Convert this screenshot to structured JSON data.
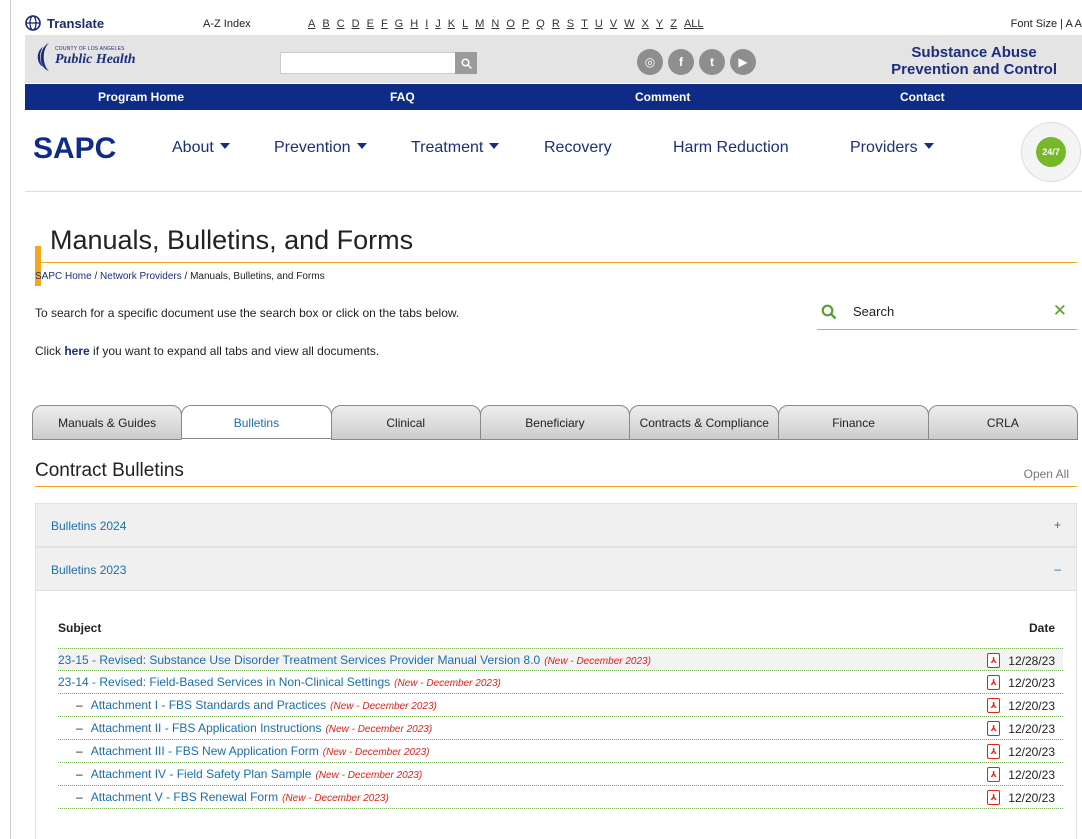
{
  "utility": {
    "translate": "Translate",
    "az_label": "A-Z Index",
    "letters": [
      "A",
      "B",
      "C",
      "D",
      "E",
      "F",
      "G",
      "H",
      "I",
      "J",
      "K",
      "L",
      "M",
      "N",
      "O",
      "P",
      "Q",
      "R",
      "S",
      "T",
      "U",
      "V",
      "W",
      "X",
      "Y",
      "Z",
      "ALL"
    ],
    "font_size": "Font Size | A A"
  },
  "logo": {
    "small": "COUNTY OF LOS ANGELES",
    "big": "Public Health"
  },
  "social": [
    {
      "icon": "instagram-icon",
      "glyph": "◎"
    },
    {
      "icon": "facebook-icon",
      "glyph": "f"
    },
    {
      "icon": "twitter-icon",
      "glyph": "t"
    },
    {
      "icon": "youtube-icon",
      "glyph": "▶"
    }
  ],
  "org": {
    "line1": "Substance Abuse",
    "line2": "Prevention and Control"
  },
  "navband": [
    "Program Home",
    "FAQ",
    "Comment",
    "Contact"
  ],
  "brand": "SAPC",
  "mainnav": [
    {
      "label": "About",
      "dropdown": true
    },
    {
      "label": "Prevention",
      "dropdown": true
    },
    {
      "label": "Treatment",
      "dropdown": true
    },
    {
      "label": "Recovery",
      "dropdown": false
    },
    {
      "label": "Harm Reduction",
      "dropdown": false
    },
    {
      "label": "Providers",
      "dropdown": true
    }
  ],
  "hotline": "24/7",
  "page": {
    "title": "Manuals, Bulletins, and Forms",
    "breadcrumb": [
      "SAPC Home",
      "Network Providers",
      "Manuals, Bulletins, and Forms"
    ],
    "instruction": "To search for a specific document use the search box or click on the tabs below.",
    "expand_pre": "Click ",
    "expand_link": "here",
    "expand_post": " if you want to expand all tabs and view all documents.",
    "search_placeholder": "Search"
  },
  "tabs": [
    {
      "label": "Manuals & Guides",
      "active": false
    },
    {
      "label": "Bulletins",
      "active": true
    },
    {
      "label": "Clinical",
      "active": false
    },
    {
      "label": "Beneficiary",
      "active": false
    },
    {
      "label": "Contracts & Compliance",
      "active": false
    },
    {
      "label": "Finance",
      "active": false
    },
    {
      "label": "CRLA",
      "active": false
    }
  ],
  "section": {
    "title": "Contract Bulletins",
    "open_all": "Open All",
    "accordions": [
      {
        "label": "Bulletins 2024",
        "symbol": "+"
      },
      {
        "label": "Bulletins 2023",
        "symbol": "–"
      }
    ],
    "table": {
      "col_subject": "Subject",
      "col_date": "Date",
      "pdf_glyph": "⅄",
      "rows": [
        {
          "subject": "23-15 - Revised: Substance Use Disorder Treatment Services Provider Manual Version 8.0",
          "tag": "(New - December 2023)",
          "date": "12/28/23",
          "indent": false
        },
        {
          "subject": "23-14 - Revised: Field-Based Services in Non-Clinical Settings",
          "tag": "(New - December 2023)",
          "date": "12/20/23",
          "indent": false
        },
        {
          "subject": "Attachment I - FBS Standards and Practices",
          "tag": "(New - December 2023)",
          "date": "12/20/23",
          "indent": true
        },
        {
          "subject": "Attachment II - FBS Application Instructions",
          "tag": "(New - December 2023)",
          "date": "12/20/23",
          "indent": true
        },
        {
          "subject": "Attachment III - FBS New Application Form",
          "tag": "(New - December 2023)",
          "date": "12/20/23",
          "indent": true
        },
        {
          "subject": "Attachment IV - Field Safety Plan Sample",
          "tag": "(New - December 2023)",
          "date": "12/20/23",
          "indent": true
        },
        {
          "subject": "Attachment V - FBS Renewal Form",
          "tag": "(New - December 2023)",
          "date": "12/20/23",
          "indent": true
        }
      ]
    }
  }
}
